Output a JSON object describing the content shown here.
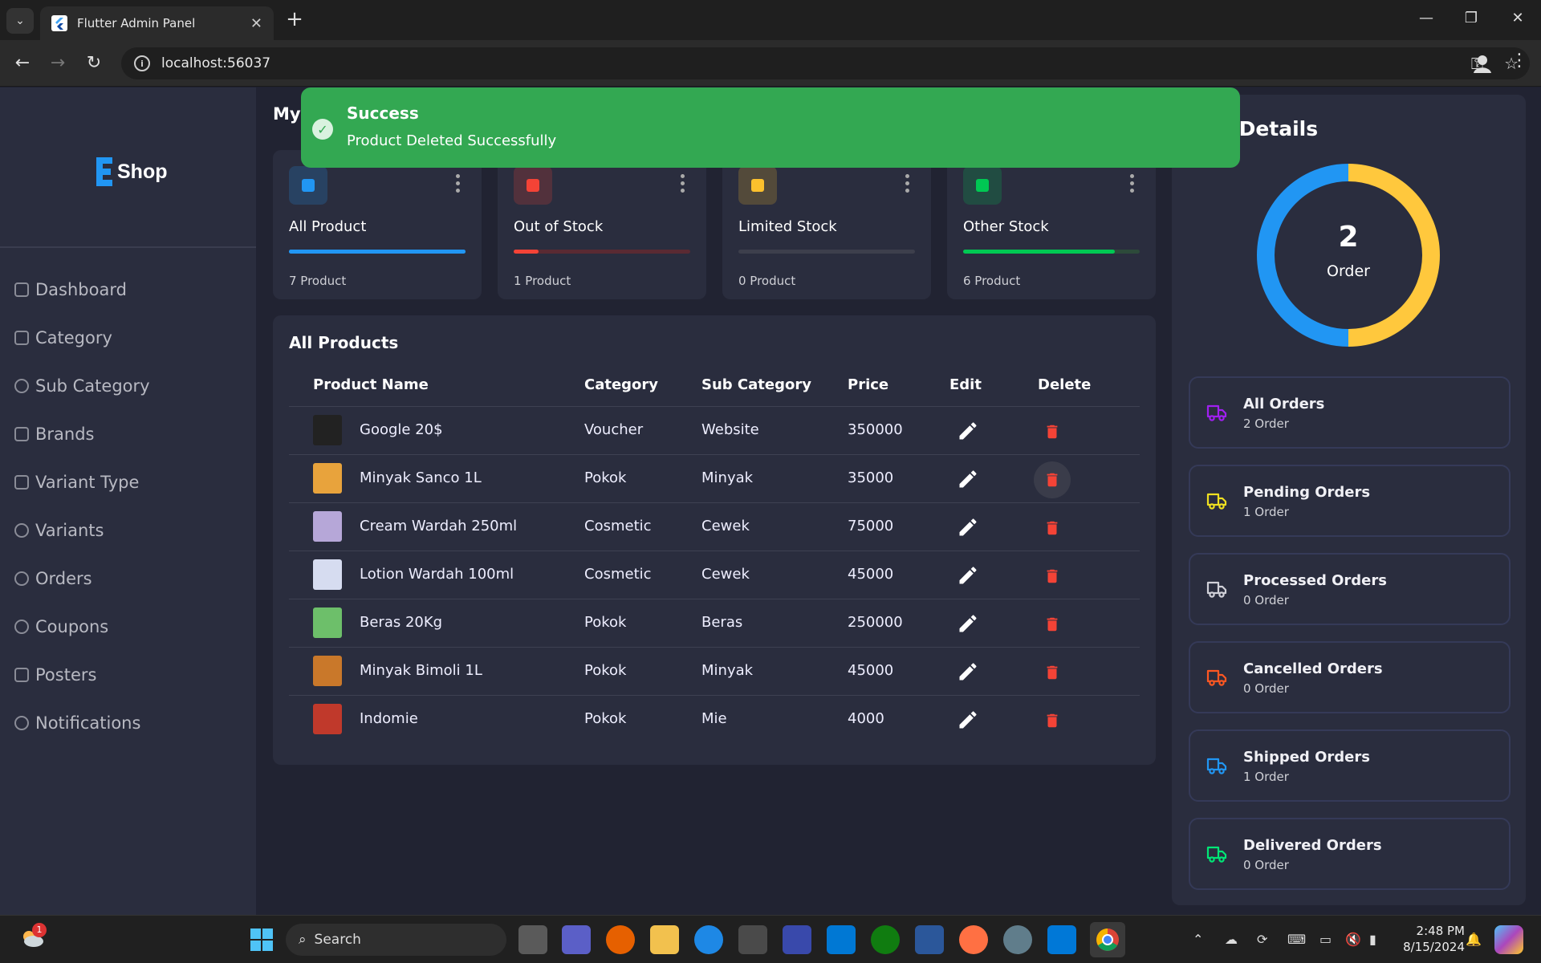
{
  "browser": {
    "tab_title": "Flutter Admin Panel",
    "url": "localhost:56037"
  },
  "sidebar": {
    "logo_text": "Shop",
    "items": [
      {
        "label": "Dashboard",
        "icon": "dashboard-icon"
      },
      {
        "label": "Category",
        "icon": "category-icon"
      },
      {
        "label": "Sub Category",
        "icon": "sub-category-icon"
      },
      {
        "label": "Brands",
        "icon": "brands-icon"
      },
      {
        "label": "Variant Type",
        "icon": "variant-type-icon"
      },
      {
        "label": "Variants",
        "icon": "variants-icon"
      },
      {
        "label": "Orders",
        "icon": "orders-icon"
      },
      {
        "label": "Coupons",
        "icon": "coupons-icon"
      },
      {
        "label": "Posters",
        "icon": "posters-icon"
      },
      {
        "label": "Notifications",
        "icon": "notifications-icon"
      }
    ]
  },
  "main": {
    "title": "My",
    "stats": [
      {
        "title": "All Product",
        "count": "7 Product",
        "color": "#2196f3",
        "progress": 1.0,
        "track": "#2196f3"
      },
      {
        "title": "Out of Stock",
        "count": "1 Product",
        "color": "#f44336",
        "progress": 0.14,
        "track": "#5a2a33"
      },
      {
        "title": "Limited Stock",
        "count": "0 Product",
        "color": "#fbc02d",
        "progress": 0.0,
        "track": "#3d3f4c"
      },
      {
        "title": "Other Stock",
        "count": "6 Product",
        "color": "#00c853",
        "progress": 0.86,
        "track": "#2d4a3a"
      }
    ]
  },
  "products": {
    "title": "All Products",
    "headers": {
      "name": "Product Name",
      "category": "Category",
      "sub_category": "Sub Category",
      "price": "Price",
      "edit": "Edit",
      "delete": "Delete"
    },
    "rows": [
      {
        "name": "Google 20$",
        "category": "Voucher",
        "sub_category": "Website",
        "price": "350000",
        "thumb": "#222"
      },
      {
        "name": "Minyak Sanco 1L",
        "category": "Pokok",
        "sub_category": "Minyak",
        "price": "35000",
        "thumb": "#e8a33c"
      },
      {
        "name": "Cream Wardah 250ml",
        "category": "Cosmetic",
        "sub_category": "Cewek",
        "price": "75000",
        "thumb": "#b6a7d8"
      },
      {
        "name": "Lotion Wardah 100ml",
        "category": "Cosmetic",
        "sub_category": "Cewek",
        "price": "45000",
        "thumb": "#d6dcf0"
      },
      {
        "name": "Beras 20Kg",
        "category": "Pokok",
        "sub_category": "Beras",
        "price": "250000",
        "thumb": "#6dbf6a"
      },
      {
        "name": "Minyak Bimoli 1L",
        "category": "Pokok",
        "sub_category": "Minyak",
        "price": "45000",
        "thumb": "#c9782a"
      },
      {
        "name": "Indomie",
        "category": "Pokok",
        "sub_category": "Mie",
        "price": "4000",
        "thumb": "#c0392b"
      }
    ]
  },
  "orders": {
    "title": "s Details",
    "donut_value": "2",
    "donut_label": "Order",
    "donut_segments": [
      {
        "color": "#ffc83d",
        "value": 1
      },
      {
        "color": "#2196f3",
        "value": 1
      }
    ],
    "cards": [
      {
        "name": "All Orders",
        "count": "2 Order",
        "icon_color": "#a020f0"
      },
      {
        "name": "Pending Orders",
        "count": "1 Order",
        "icon_color": "#f0e020"
      },
      {
        "name": "Processed Orders",
        "count": "0 Order",
        "icon_color": "#d0d0d8"
      },
      {
        "name": "Cancelled Orders",
        "count": "0 Order",
        "icon_color": "#ff5722"
      },
      {
        "name": "Shipped Orders",
        "count": "1 Order",
        "icon_color": "#2196f3"
      },
      {
        "name": "Delivered Orders",
        "count": "0 Order",
        "icon_color": "#00e676"
      }
    ]
  },
  "toast": {
    "title": "Success",
    "message": "Product Deleted Successfully"
  },
  "taskbar": {
    "search_label": "Search",
    "time": "2:48 PM",
    "date": "8/15/2024",
    "weather_badge": "1"
  }
}
